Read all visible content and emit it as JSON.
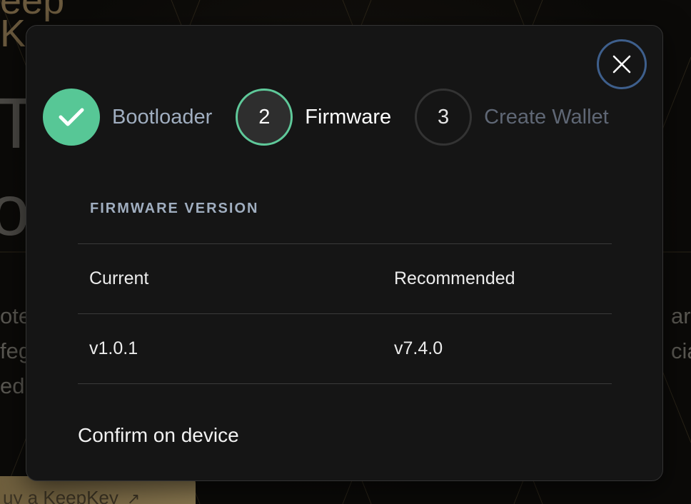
{
  "background": {
    "logo_line1": "eep",
    "logo_line2": "Key",
    "hero_line1": "T",
    "hero_line2": "of",
    "left_text_fragments": "ote\nfeg\ned",
    "right_text_fragments": "ar\ncia",
    "buy_button_label": "uy a KeepKey",
    "buy_button_icon": "external-link-icon"
  },
  "modal": {
    "close_icon": "close-icon",
    "steps": [
      {
        "label": "Bootloader",
        "marker": "✓",
        "state": "done"
      },
      {
        "label": "Firmware",
        "marker": "2",
        "state": "active"
      },
      {
        "label": "Create Wallet",
        "marker": "3",
        "state": "pending"
      }
    ],
    "section_title": "FIRMWARE VERSION",
    "table": {
      "headers": [
        "Current",
        "Recommended"
      ],
      "rows": [
        [
          "v1.0.1",
          "v7.4.0"
        ]
      ]
    },
    "confirm_text": "Confirm on device"
  },
  "colors": {
    "accent_green": "#57c796",
    "close_ring_blue": "#3e5f8c",
    "modal_bg": "#151515",
    "brand_gold": "#8a7850"
  }
}
